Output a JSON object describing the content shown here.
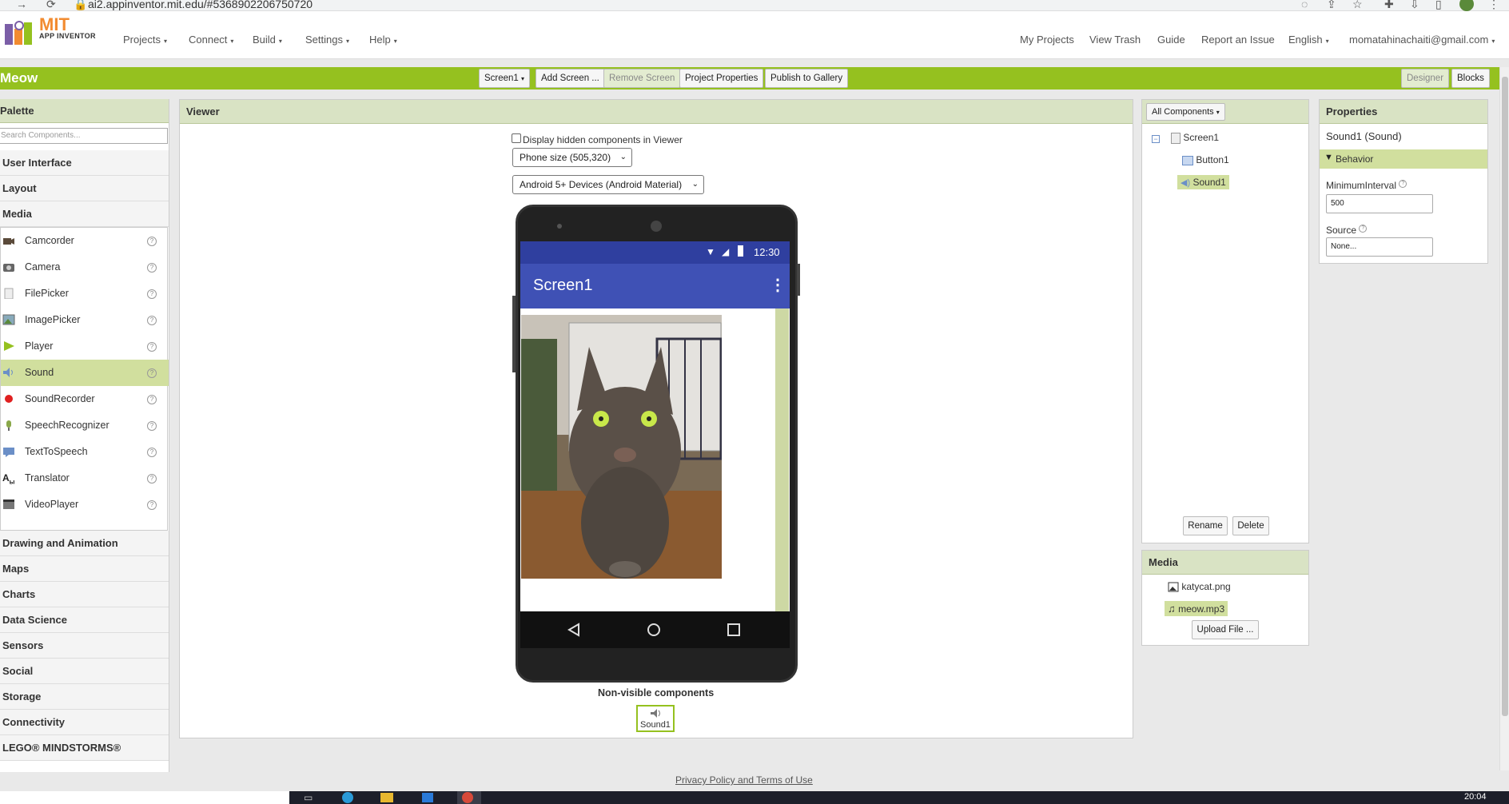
{
  "browser": {
    "url": "ai2.appinventor.mit.edu/#5368902206750720"
  },
  "colors": {
    "brand_green": "#95c11f",
    "panel_header": "#d9e3c4",
    "selection": "#d1df9e",
    "app_bar": "#3f51b5",
    "logo_orange": "#f28b30"
  },
  "logo": {
    "mit": "MIT",
    "app_inventor": "APP INVENTOR"
  },
  "nav": {
    "left": [
      "Projects",
      "Connect",
      "Build",
      "Settings",
      "Help"
    ],
    "my_projects": "My Projects",
    "view_trash": "View Trash",
    "guide": "Guide",
    "report_issue": "Report an Issue",
    "language": "English",
    "account": "momatahinachaiti@gmail.com"
  },
  "toolbar": {
    "project_name": "Meow",
    "screen_select": "Screen1",
    "add_screen": "Add Screen ...",
    "remove_screen": "Remove Screen",
    "project_properties": "Project Properties",
    "publish": "Publish to Gallery",
    "designer": "Designer",
    "blocks": "Blocks"
  },
  "palette": {
    "title": "Palette",
    "search_placeholder": "Search Components...",
    "top_categories": [
      "User Interface",
      "Layout",
      "Media"
    ],
    "media_components": [
      {
        "label": "Camcorder",
        "icon": "camcorder-icon"
      },
      {
        "label": "Camera",
        "icon": "camera-icon"
      },
      {
        "label": "FilePicker",
        "icon": "filepicker-icon"
      },
      {
        "label": "ImagePicker",
        "icon": "imagepicker-icon"
      },
      {
        "label": "Player",
        "icon": "player-icon"
      },
      {
        "label": "Sound",
        "icon": "sound-icon"
      },
      {
        "label": "SoundRecorder",
        "icon": "soundrecorder-icon"
      },
      {
        "label": "SpeechRecognizer",
        "icon": "speechrecognizer-icon"
      },
      {
        "label": "TextToSpeech",
        "icon": "texttospeech-icon"
      },
      {
        "label": "Translator",
        "icon": "translator-icon"
      },
      {
        "label": "VideoPlayer",
        "icon": "videoplayer-icon"
      }
    ],
    "bottom_categories": [
      "Drawing and Animation",
      "Maps",
      "Charts",
      "Data Science",
      "Sensors",
      "Social",
      "Storage",
      "Connectivity",
      "LEGO® MINDSTORMS®"
    ]
  },
  "viewer": {
    "title": "Viewer",
    "hidden_checkbox_label": "Display hidden components in Viewer",
    "phone_size": "Phone size (505,320)",
    "device_theme": "Android 5+ Devices (Android Material)",
    "status_time": "12:30",
    "screen_title": "Screen1",
    "nonvisible_title": "Non-visible components",
    "nonvisible_item": "Sound1"
  },
  "components": {
    "filter": "All Components",
    "tree": [
      "Screen1",
      "Button1",
      "Sound1"
    ],
    "rename": "Rename",
    "delete": "Delete"
  },
  "media": {
    "title": "Media",
    "files": [
      "katycat.png",
      "meow.mp3"
    ],
    "upload": "Upload File ..."
  },
  "properties": {
    "title": "Properties",
    "subtitle": "Sound1 (Sound)",
    "section": "Behavior",
    "min_interval_label": "MinimumInterval",
    "min_interval_value": "500",
    "source_label": "Source",
    "source_value": "None..."
  },
  "footer": {
    "privacy": "Privacy Policy and Terms of Use"
  },
  "taskbar": {
    "time": "20:04"
  }
}
